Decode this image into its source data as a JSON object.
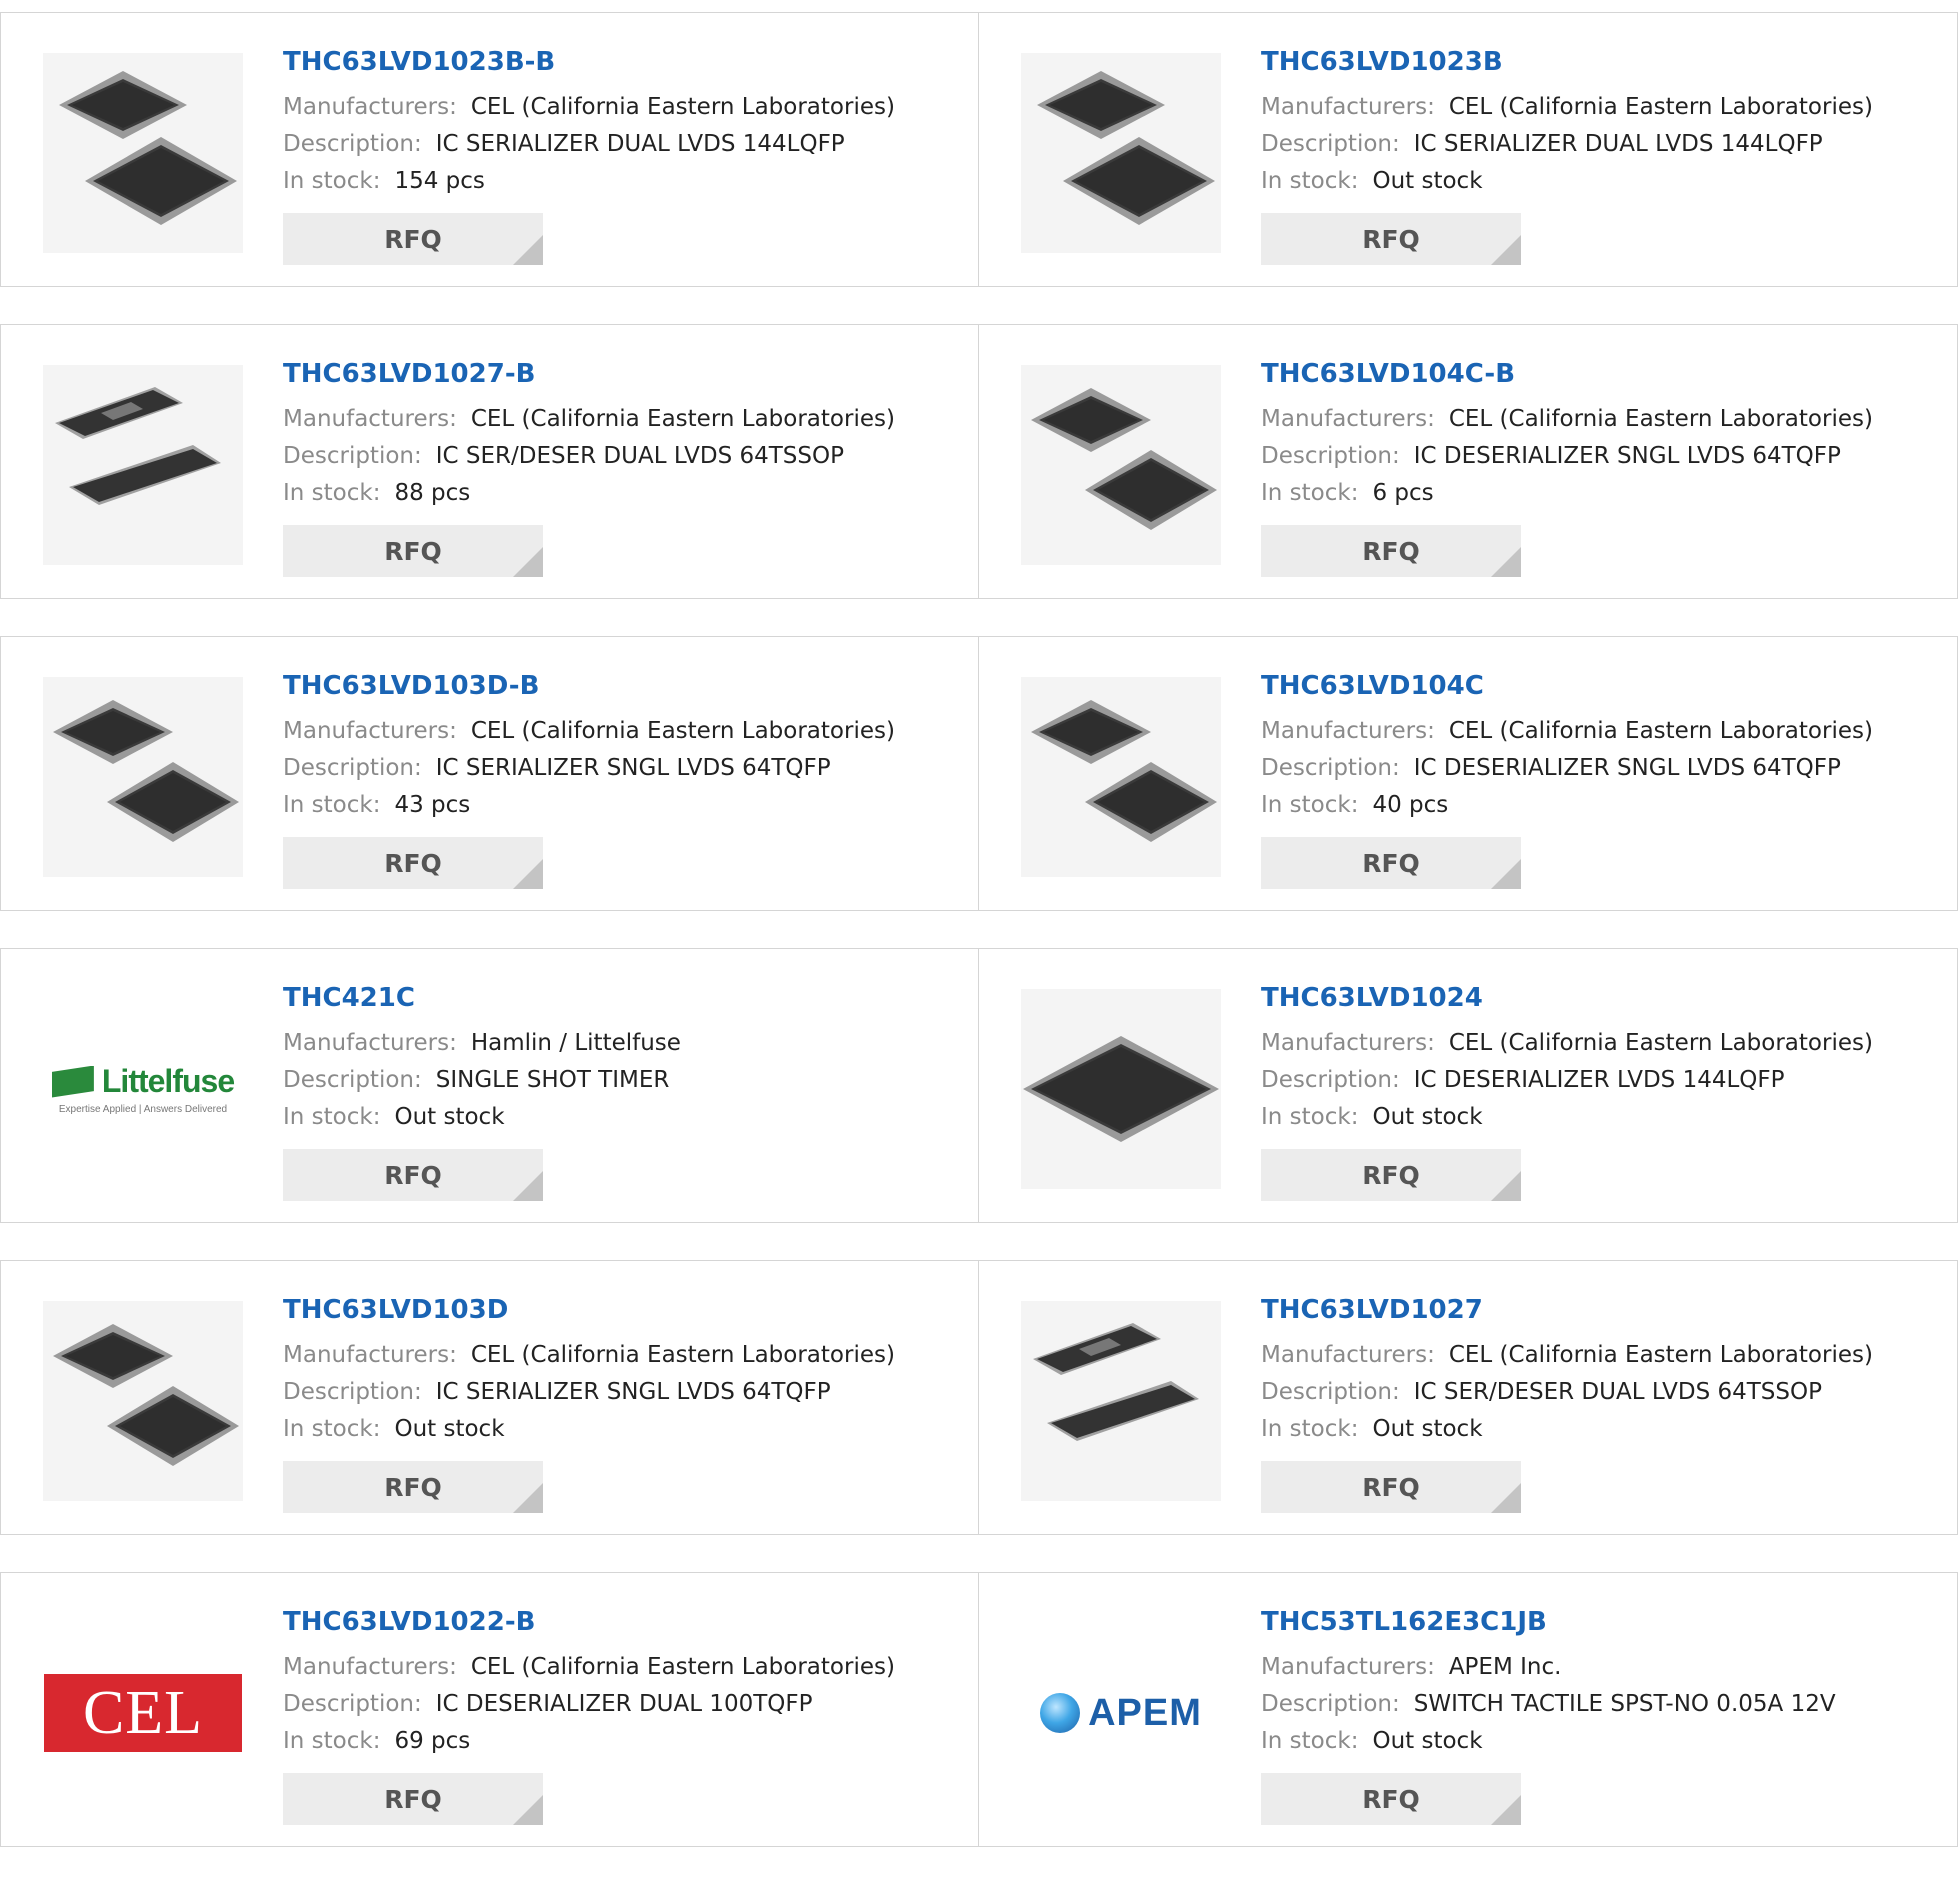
{
  "labels": {
    "manufacturers": "Manufacturers:",
    "description": "Description:",
    "in_stock": "In stock:",
    "rfq": "RFQ"
  },
  "logos": {
    "littelfuse_name": "Littelfuse",
    "littelfuse_tagline": "Expertise Applied | Answers Delivered",
    "cel_name": "CEL",
    "apem_name": "APEM"
  },
  "colors": {
    "link_blue": "#1a64b4",
    "label_gray": "#8a8a8a",
    "button_bg": "#ececec"
  },
  "products": [
    {
      "part": "THC63LVD1023B-B",
      "manufacturer": "CEL (California Eastern Laboratories)",
      "description": "IC SERIALIZER DUAL LVDS 144LQFP",
      "stock": "154 pcs",
      "image": "qfp-chip-icon"
    },
    {
      "part": "THC63LVD1023B",
      "manufacturer": "CEL (California Eastern Laboratories)",
      "description": "IC SERIALIZER DUAL LVDS 144LQFP",
      "stock": "Out stock",
      "image": "qfp-chip-icon"
    },
    {
      "part": "THC63LVD1027-B",
      "manufacturer": "CEL (California Eastern Laboratories)",
      "description": "IC SER/DESER DUAL LVDS 64TSSOP",
      "stock": "88 pcs",
      "image": "tssop-chip-icon"
    },
    {
      "part": "THC63LVD104C-B",
      "manufacturer": "CEL (California Eastern Laboratories)",
      "description": "IC DESERIALIZER SNGL LVDS 64TQFP",
      "stock": "6 pcs",
      "image": "tqfp-chip-icon"
    },
    {
      "part": "THC63LVD103D-B",
      "manufacturer": "CEL (California Eastern Laboratories)",
      "description": "IC SERIALIZER SNGL LVDS 64TQFP",
      "stock": "43 pcs",
      "image": "tqfp-chip-icon"
    },
    {
      "part": "THC63LVD104C",
      "manufacturer": "CEL (California Eastern Laboratories)",
      "description": "IC DESERIALIZER SNGL LVDS 64TQFP",
      "stock": "40 pcs",
      "image": "tqfp-chip-icon"
    },
    {
      "part": "THC421C",
      "manufacturer": "Hamlin / Littelfuse",
      "description": "SINGLE SHOT TIMER",
      "stock": "Out stock",
      "image": "littelfuse-logo"
    },
    {
      "part": "THC63LVD1024",
      "manufacturer": "CEL (California Eastern Laboratories)",
      "description": "IC DESERIALIZER LVDS 144LQFP",
      "stock": "Out stock",
      "image": "single-qfp-chip-icon"
    },
    {
      "part": "THC63LVD103D",
      "manufacturer": "CEL (California Eastern Laboratories)",
      "description": "IC SERIALIZER SNGL LVDS 64TQFP",
      "stock": "Out stock",
      "image": "tqfp-chip-icon"
    },
    {
      "part": "THC63LVD1027",
      "manufacturer": "CEL (California Eastern Laboratories)",
      "description": "IC SER/DESER DUAL LVDS 64TSSOP",
      "stock": "Out stock",
      "image": "tssop-chip-icon"
    },
    {
      "part": "THC63LVD1022-B",
      "manufacturer": "CEL (California Eastern Laboratories)",
      "description": "IC DESERIALIZER DUAL 100TQFP",
      "stock": "69 pcs",
      "image": "cel-logo"
    },
    {
      "part": "THC53TL162E3C1JB",
      "manufacturer": "APEM Inc.",
      "description": "SWITCH TACTILE SPST-NO 0.05A 12V",
      "stock": "Out stock",
      "image": "apem-logo"
    }
  ]
}
